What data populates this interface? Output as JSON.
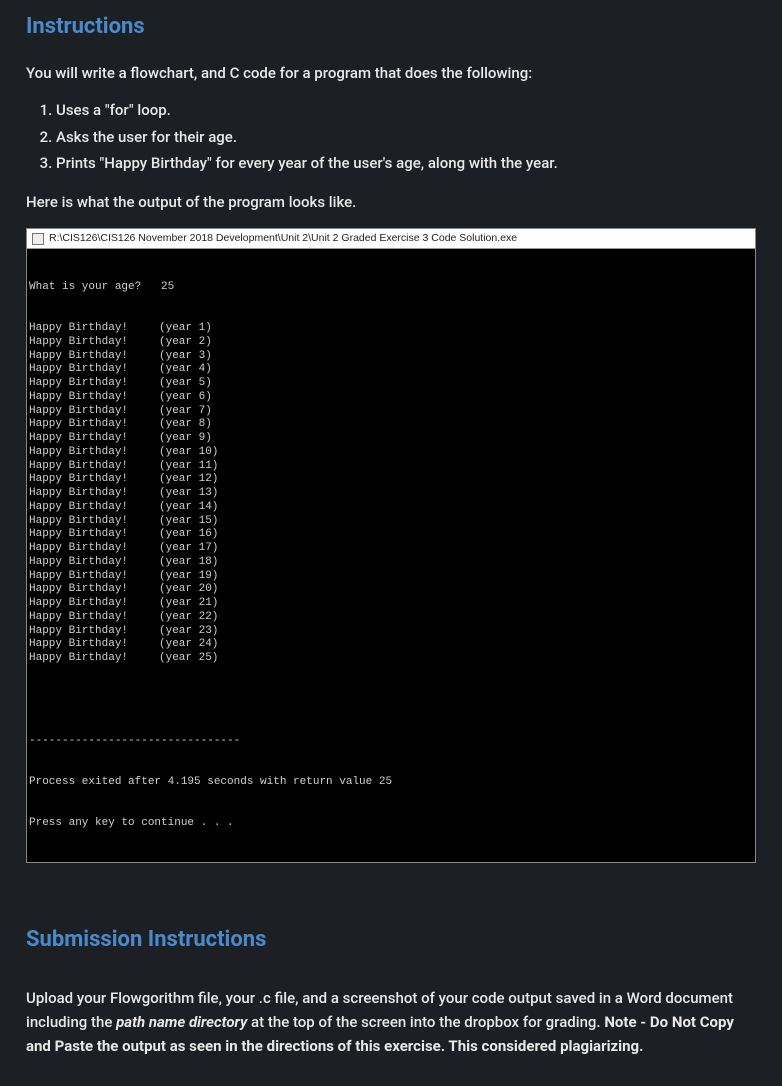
{
  "instructions": {
    "heading": "Instructions",
    "intro": "You will write a flowchart, and C code for a program that does the following:",
    "items": [
      "Uses a \"for\" loop.",
      "Asks the user for their age.",
      "Prints \"Happy Birthday\" for every year of the user's age, along with the year."
    ],
    "output_intro": "Here is what the output of the program looks like."
  },
  "terminal": {
    "title": "R:\\CIS126\\CIS126 November 2018 Development\\Unit 2\\Unit 2 Graded Exercise 3 Code Solution.exe",
    "prompt": "What is your age?   25",
    "msg": "Happy Birthday!",
    "years": [
      1,
      2,
      3,
      4,
      5,
      6,
      7,
      8,
      9,
      10,
      11,
      12,
      13,
      14,
      15,
      16,
      17,
      18,
      19,
      20,
      21,
      22,
      23,
      24,
      25
    ],
    "divider": "--------------------------------",
    "exit_line": "Process exited after 4.195 seconds with return value 25",
    "press_line": "Press any key to continue . . ."
  },
  "submission": {
    "heading": "Submission Instructions",
    "pre": "Upload your Flowgorithm file, your .c file, and a screenshot of your code output saved in a Word document including the ",
    "path_phrase": "path name directory",
    "mid": " at the top of the screen into the dropbox for grading.  ",
    "note": "Note - Do Not Copy and Paste the output as seen in the directions of this exercise. This considered plagiarizing."
  }
}
